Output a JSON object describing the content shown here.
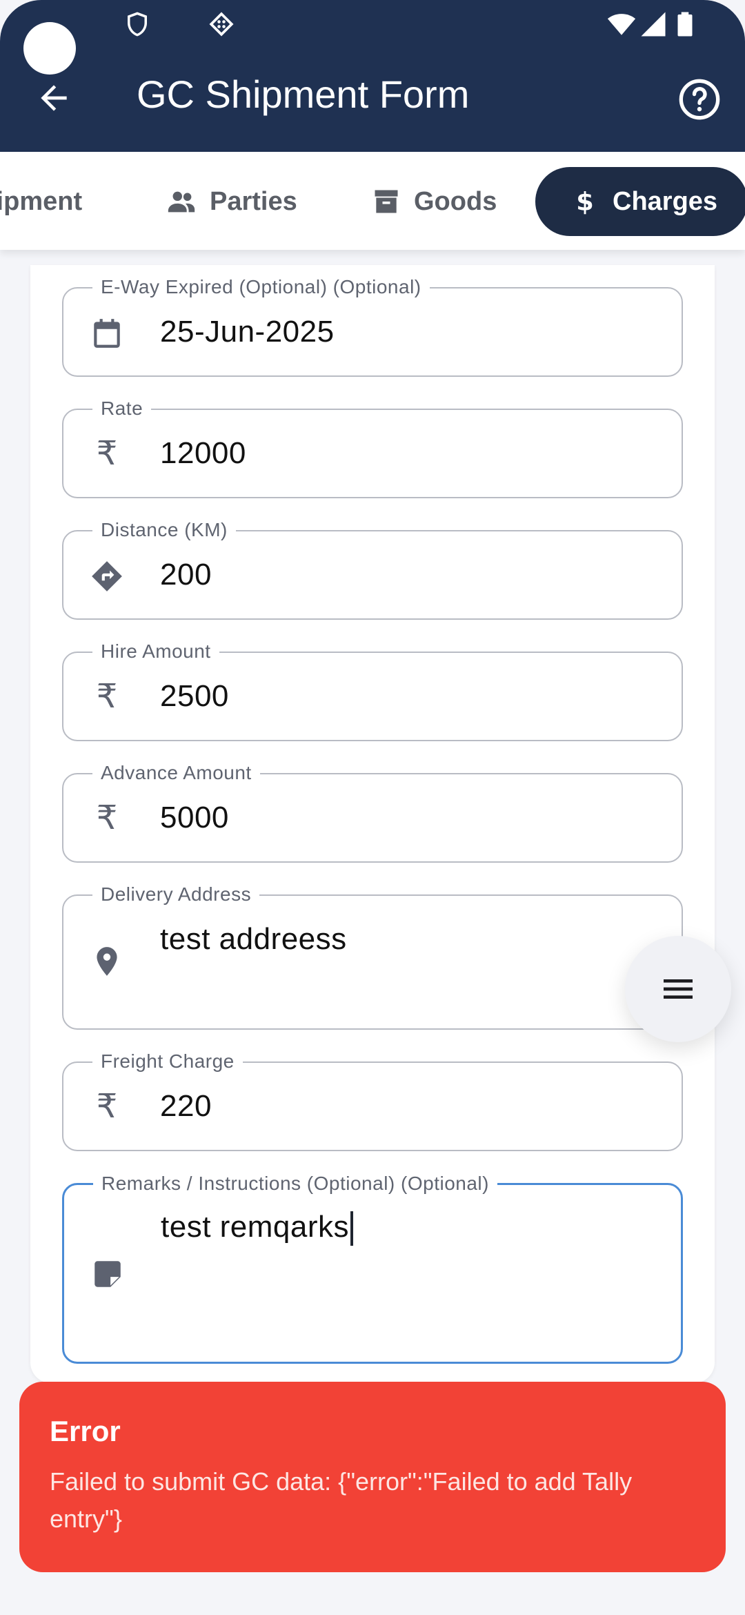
{
  "app": {
    "title": "GC Shipment Form"
  },
  "tabs": [
    {
      "label": "Shipment",
      "icon": "truck-icon"
    },
    {
      "label": "Parties",
      "icon": "people-icon"
    },
    {
      "label": "Goods",
      "icon": "archive-icon"
    },
    {
      "label": "Charges",
      "icon": "dollar-icon",
      "active": true
    }
  ],
  "fields": [
    {
      "label": "E-Way Expired (Optional) (Optional)",
      "value": "25-Jun-2025",
      "icon": "calendar-icon"
    },
    {
      "label": "Rate",
      "value": "12000",
      "icon": "rupee-icon"
    },
    {
      "label": "Distance (KM)",
      "value": "200",
      "icon": "directions-icon"
    },
    {
      "label": "Hire Amount",
      "value": "2500",
      "icon": "rupee-icon"
    },
    {
      "label": "Advance Amount",
      "value": "5000",
      "icon": "rupee-icon"
    },
    {
      "label": "Delivery Address",
      "value": "test addreess",
      "icon": "location-pin-icon"
    },
    {
      "label": "Freight Charge",
      "value": "220",
      "icon": "rupee-icon"
    },
    {
      "label": "Remarks / Instructions (Optional) (Optional)",
      "value": "test remqarks",
      "icon": "note-icon",
      "focused": true
    }
  ],
  "error": {
    "title": "Error",
    "message": "Failed to submit GC data: {\"error\":\"Failed to add Tally entry\"}"
  },
  "colors": {
    "header": "#1f3152",
    "active_tab": "#1e2c45",
    "focus": "#4a8bd6",
    "error": "#f24236"
  }
}
